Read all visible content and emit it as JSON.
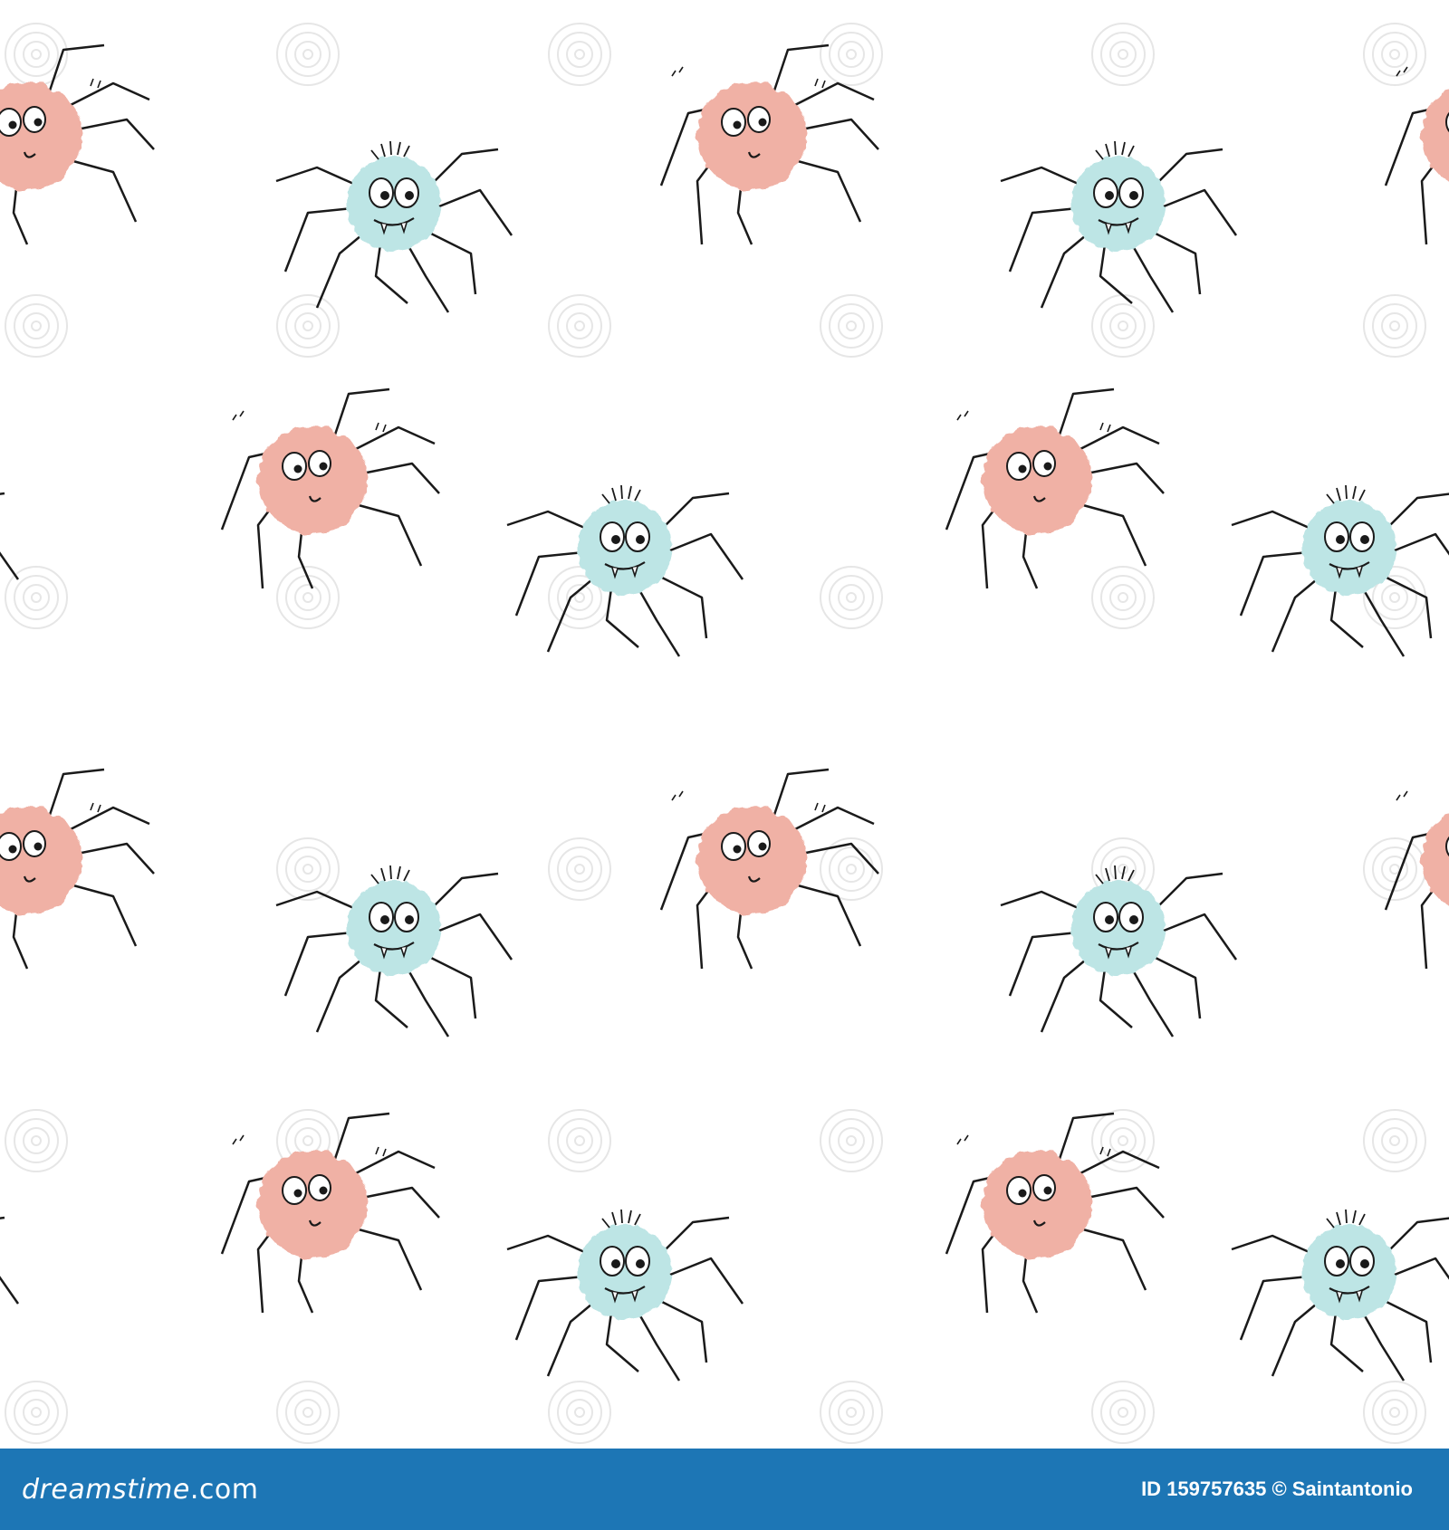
{
  "image": {
    "background": "#ffffff",
    "colors": {
      "pink_spider": "#f0b1a5",
      "blue_spider": "#bde5e5",
      "outline": "#1a1a1a",
      "watermark": "#e6e6e6"
    }
  },
  "footer": {
    "background": "#1d76b5",
    "logo_main": "dreamstime",
    "logo_suffix": ".com",
    "id_label": "ID",
    "id_value": "159757635",
    "copyright_symbol": "©",
    "author": "Saintantonio"
  },
  "spiders": [
    {
      "color": "pink",
      "row": 1,
      "col": 1
    },
    {
      "color": "pink",
      "row": 1,
      "col": 2
    },
    {
      "color": "pink",
      "row": 1,
      "col": 3
    },
    {
      "color": "blue",
      "row": 1,
      "col": 1
    },
    {
      "color": "blue",
      "row": 1,
      "col": 2
    },
    {
      "color": "pink",
      "row": 2,
      "col": 1
    },
    {
      "color": "pink",
      "row": 2,
      "col": 2
    },
    {
      "color": "blue",
      "row": 2,
      "col": 1
    },
    {
      "color": "blue",
      "row": 2,
      "col": 2
    },
    {
      "color": "blue",
      "row": 2,
      "col": 3
    },
    {
      "color": "pink",
      "row": 3,
      "col": 1
    },
    {
      "color": "pink",
      "row": 3,
      "col": 2
    },
    {
      "color": "pink",
      "row": 3,
      "col": 3
    },
    {
      "color": "blue",
      "row": 3,
      "col": 1
    },
    {
      "color": "blue",
      "row": 3,
      "col": 2
    },
    {
      "color": "pink",
      "row": 4,
      "col": 1
    },
    {
      "color": "pink",
      "row": 4,
      "col": 2
    },
    {
      "color": "blue",
      "row": 4,
      "col": 1
    },
    {
      "color": "blue",
      "row": 4,
      "col": 2
    },
    {
      "color": "blue",
      "row": 4,
      "col": 3
    }
  ]
}
